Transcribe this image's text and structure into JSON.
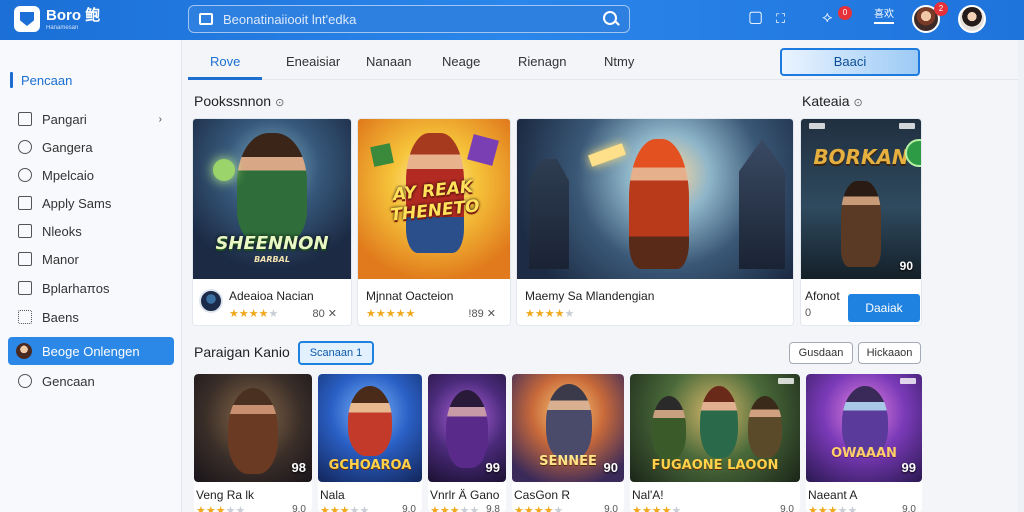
{
  "header": {
    "logo_title": "Boro 鲍",
    "logo_subtitle": "Hanamesan",
    "search_placeholder": "Beonatinaiiooit lnt'edka",
    "notif_count": "0",
    "profile_label": "喜欢",
    "avatar_badge": "2"
  },
  "sidebar": {
    "brand": "Pencaan",
    "items": [
      {
        "label": "Pangari",
        "icon": "folder-icon",
        "has_chevron": true
      },
      {
        "label": "Gangera",
        "icon": "magnifier-icon"
      },
      {
        "label": "Mpelcaio",
        "icon": "search-icon"
      },
      {
        "label": "Apply Sams",
        "icon": "document-icon"
      },
      {
        "label": "Nleoks",
        "icon": "square-icon"
      },
      {
        "label": "Manor",
        "icon": "folder-icon"
      },
      {
        "label": "Bplarhaπos",
        "icon": "clipboard-icon"
      },
      {
        "label": "Baens",
        "icon": "grid-icon"
      }
    ],
    "active_item": {
      "label": "Beoge Onlengen",
      "icon": "avatar"
    },
    "footer_item": {
      "label": "Gencaan",
      "icon": "refresh-icon"
    }
  },
  "tabs": {
    "items": [
      "Rove",
      "Eneaisiar",
      "Nanaan",
      "Neage",
      "Rienagn",
      "Ntmy"
    ],
    "active": "Rove",
    "cta": "Baaci"
  },
  "featured": {
    "title": "Pookssnnon",
    "side_title": "Kateaia",
    "cards": [
      {
        "name": "Adeaioa Nacian",
        "art_title": "SHEENNON",
        "art_subtitle": "BARBAL",
        "stars": 3.5,
        "meta": "80 ✕"
      },
      {
        "name": "Mjnnat Oacteion",
        "art_title": "AY REAK THENETO",
        "stars": 4.5,
        "meta": "!89 ✕"
      },
      {
        "name": "Maemy Sa Mlandengian",
        "art_title": "",
        "stars": 4,
        "meta": ""
      },
      {
        "name": "Afonot",
        "art_title": "BORKAN",
        "stars": 0,
        "meta": "0",
        "badge": "90",
        "button": "Daaiak"
      }
    ]
  },
  "row2": {
    "title": "Paraigan Kanio",
    "chip_active": "Scanaan 1",
    "chip_a": "Gusdaan",
    "chip_b": "Hickaaon",
    "cards": [
      {
        "name": "Veng Ra lk",
        "art_title": "",
        "rating": "98",
        "stars": 3,
        "meta": "9.0"
      },
      {
        "name": "Nala",
        "art_title": "GCHOAROA",
        "rating": "",
        "stars": 3,
        "meta": "9.0"
      },
      {
        "name": "Vnrlr Ä Gano",
        "art_title": "",
        "rating": "99",
        "stars": 3,
        "meta": "9.8"
      },
      {
        "name": "CasGon R",
        "art_title": "SENNEE",
        "rating": "90",
        "stars": 4,
        "meta": "9.0"
      },
      {
        "name": "Nal'A!",
        "art_title": "FUGAONE LAOON",
        "rating": "",
        "stars": 4,
        "meta": "9.0"
      },
      {
        "name": "Naeant A",
        "art_title": "OWAAAN",
        "rating": "99",
        "stars": 3,
        "meta": "9.0"
      }
    ]
  },
  "colors": {
    "header_blue": "#1f74dc",
    "accent": "#1f82e0",
    "star": "#f0a81c"
  }
}
